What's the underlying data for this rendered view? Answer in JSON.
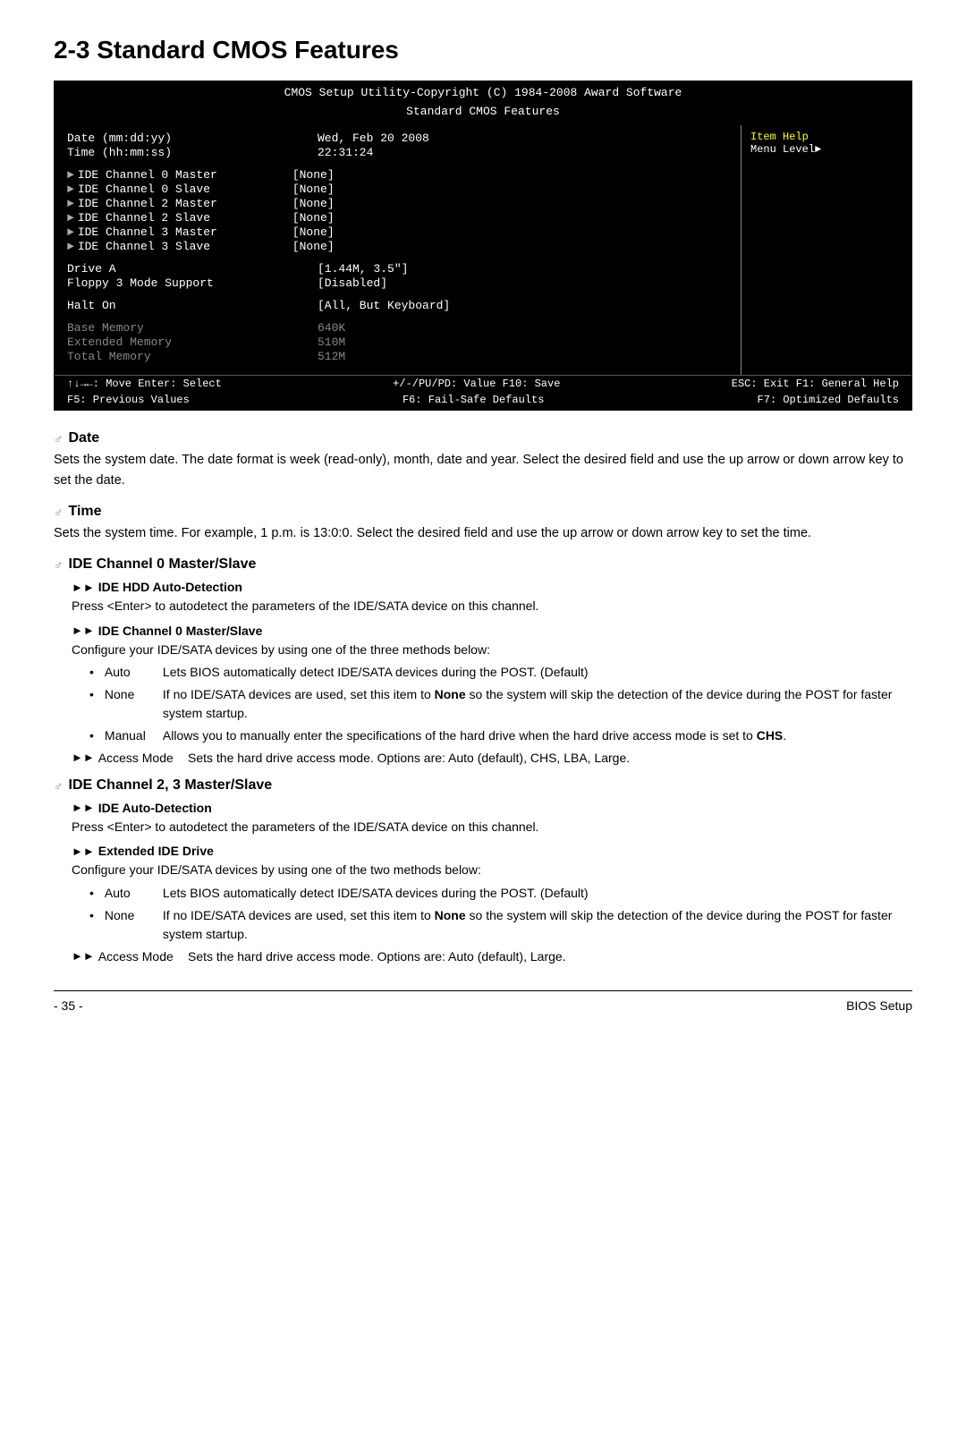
{
  "page": {
    "title": "2-3   Standard CMOS Features",
    "footer_left": "- 35 -",
    "footer_right": "BIOS Setup"
  },
  "bios_screen": {
    "header_line1": "CMOS Setup Utility-Copyright (C) 1984-2008 Award Software",
    "header_line2": "Standard CMOS Features",
    "rows": [
      {
        "label": "Date (mm:dd:yy)",
        "value": "Wed, Feb  20  2008",
        "type": "active"
      },
      {
        "label": "Time (hh:mm:ss)",
        "value": "22:31:24",
        "type": "active"
      },
      {
        "label": "IDE Channel 0 Master",
        "value": "[None]",
        "type": "arrow"
      },
      {
        "label": "IDE Channel 0 Slave",
        "value": "[None]",
        "type": "arrow"
      },
      {
        "label": "IDE Channel 2 Master",
        "value": "[None]",
        "type": "arrow"
      },
      {
        "label": "IDE Channel 2 Slave",
        "value": "[None]",
        "type": "arrow"
      },
      {
        "label": "IDE Channel 3 Master",
        "value": "[None]",
        "type": "arrow"
      },
      {
        "label": "IDE Channel 3 Slave",
        "value": "[None]",
        "type": "arrow"
      },
      {
        "label": "Drive A",
        "value": "[1.44M, 3.5\"]",
        "type": "active"
      },
      {
        "label": "Floppy 3 Mode Support",
        "value": "[Disabled]",
        "type": "active"
      },
      {
        "label": "Halt On",
        "value": "[All, But Keyboard]",
        "type": "active"
      },
      {
        "label": "Base Memory",
        "value": "640K",
        "type": "gray"
      },
      {
        "label": "Extended Memory",
        "value": "510M",
        "type": "gray"
      },
      {
        "label": "Total Memory",
        "value": "512M",
        "type": "gray"
      }
    ],
    "item_help_title": "Item Help",
    "item_help_text": "Menu Level►",
    "footer": {
      "col1": "↑↓→←: Move    Enter: Select",
      "col2": "+/-/PU/PD: Value    F10: Save",
      "col3": "ESC: Exit    F1: General Help",
      "col4": "F5: Previous Values",
      "col5": "F6: Fail-Safe Defaults",
      "col6": "F7: Optimized Defaults"
    }
  },
  "sections": {
    "date": {
      "heading": "Date",
      "text": "Sets the system date. The date format is week (read-only), month, date and year. Select the desired field and use the up arrow or down arrow key to set the date."
    },
    "time": {
      "heading": "Time",
      "text": "Sets the system time. For example, 1 p.m. is 13:0:0. Select the desired field and use the up arrow or down arrow key to set the time."
    },
    "ide_channel_0": {
      "heading": "IDE Channel 0 Master/Slave",
      "sub1_label": "►► IDE HDD Auto-Detection",
      "sub1_text": "Press <Enter> to autodetect the parameters of the IDE/SATA device on this channel.",
      "sub2_label": "►► IDE Channel 0 Master/Slave",
      "sub2_text": "Configure your IDE/SATA devices by using one of the three methods below:",
      "bullets": [
        {
          "key": "Auto",
          "value": "Lets BIOS automatically detect IDE/SATA devices during the POST. (Default)"
        },
        {
          "key": "None",
          "value": "If no IDE/SATA devices are used, set this item to None so the system will skip the detection of the device during the POST for faster system startup."
        },
        {
          "key": "Manual",
          "value": "Allows you to manually enter the specifications of the hard drive when the hard drive access mode is set to CHS."
        }
      ],
      "access_mode_label": "►► Access Mode",
      "access_mode_text": "Sets the hard drive access mode. Options are: Auto (default), CHS, LBA, Large."
    },
    "ide_channel_23": {
      "heading": "IDE Channel 2, 3 Master/Slave",
      "sub1_label": "►► IDE Auto-Detection",
      "sub1_text": "Press <Enter> to autodetect the parameters of the IDE/SATA device on this channel.",
      "sub2_label": "►► Extended IDE Drive",
      "sub2_text": "Configure your IDE/SATA devices by using one of the two methods below:",
      "bullets": [
        {
          "key": "Auto",
          "value": "Lets BIOS automatically detect IDE/SATA devices during the POST. (Default)"
        },
        {
          "key": "None",
          "value": "If no IDE/SATA devices are used, set this item to None so the system will skip the detection of the device during the POST for faster system startup."
        }
      ],
      "access_mode_label": "►► Access Mode",
      "access_mode_text": "Sets the hard drive access mode. Options are: Auto (default), Large."
    }
  }
}
